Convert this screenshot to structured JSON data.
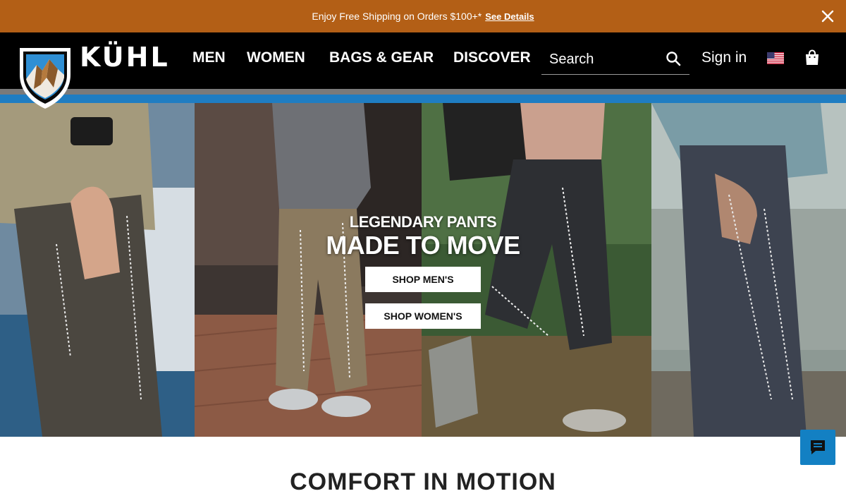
{
  "promo": {
    "message": "Enjoy Free Shipping on Orders $100+*",
    "link": "See Details",
    "close_icon": "close-icon",
    "background": "#b35f16"
  },
  "header": {
    "brand": "KÜHL",
    "nav": [
      "MEN",
      "WOMEN",
      "BAGS & GEAR",
      "DISCOVER"
    ],
    "search_placeholder": "Search",
    "search_icon": "search-icon",
    "sign_in": "Sign in",
    "flag_icon": "us-flag-icon",
    "bag_icon": "shopping-bag-icon",
    "stripe_colors": [
      "#7a7a7a",
      "#1f7dc2"
    ]
  },
  "hero": {
    "eyebrow": "LEGENDARY PANTS",
    "headline": "MADE TO MOVE",
    "cta_men": "SHOP MEN'S",
    "cta_women": "SHOP WOMEN'S"
  },
  "section": {
    "title": "COMFORT IN MOTION"
  },
  "chat": {
    "icon": "chat-icon",
    "color": "#1380c3"
  }
}
